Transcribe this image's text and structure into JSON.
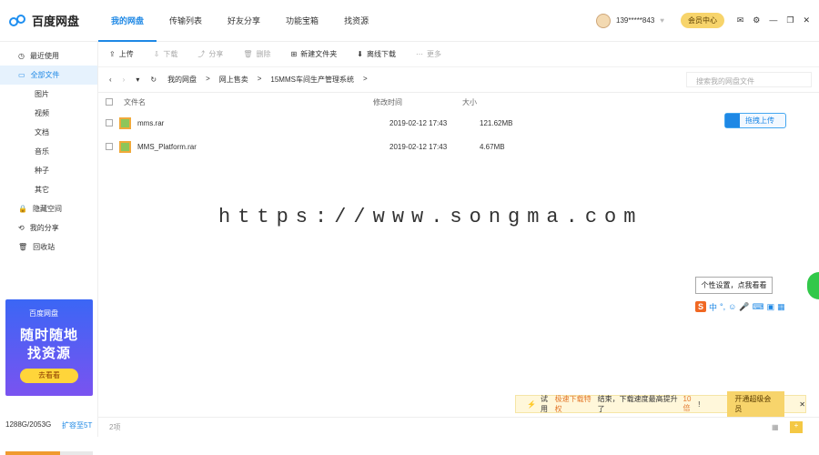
{
  "app": {
    "name": "百度网盘",
    "nav": [
      "我的网盘",
      "传输列表",
      "好友分享",
      "功能宝箱",
      "找资源"
    ],
    "user": "139*****843",
    "vip": "会员中心"
  },
  "sidebar": [
    {
      "label": "最近使用",
      "icon": "clock-icon"
    },
    {
      "label": "全部文件",
      "icon": "folder-icon",
      "active": true
    },
    {
      "label": "图片",
      "sub": true
    },
    {
      "label": "视频",
      "sub": true
    },
    {
      "label": "文档",
      "sub": true
    },
    {
      "label": "音乐",
      "sub": true
    },
    {
      "label": "种子",
      "sub": true
    },
    {
      "label": "其它",
      "sub": true
    },
    {
      "label": "隐藏空间",
      "icon": "lock-icon"
    },
    {
      "label": "我的分享",
      "icon": "share-icon"
    },
    {
      "label": "回收站",
      "icon": "trash-icon"
    }
  ],
  "ad": {
    "brand": "百度网盘",
    "line1": "随时随地",
    "line2": "找资源",
    "button": "去看看"
  },
  "quota": {
    "text": "1288G/2053G",
    "expand": "扩容至5T",
    "fraction": 0.627
  },
  "toolbar": [
    {
      "label": "上传"
    },
    {
      "label": "下载",
      "disabled": true
    },
    {
      "label": "分享",
      "disabled": true
    },
    {
      "label": "删除",
      "disabled": true
    },
    {
      "label": "新建文件夹"
    },
    {
      "label": "离线下载"
    },
    {
      "label": "更多",
      "disabled": true
    }
  ],
  "breadcrumb": [
    "我的网盘",
    "网上售卖",
    "15MMS车间生产管理系统"
  ],
  "search_placeholder": "搜索我的网盘文件",
  "columns": {
    "name": "文件名",
    "time": "修改时间",
    "size": "大小"
  },
  "files": [
    {
      "name": "mms.rar",
      "time": "2019-02-12 17:43",
      "size": "121.62MB"
    },
    {
      "name": "MMS_Platform.rar",
      "time": "2019-02-12 17:43",
      "size": "4.67MB"
    }
  ],
  "drag_upload": "拖拽上传",
  "watermark": "https://www.songma.com",
  "ime_tip": "个性设置，点我看看",
  "promo": {
    "text_pre": "试用",
    "text_hl": "极速下载特权",
    "text_mid": "结束，下载速度最高提升了",
    "highlight": "10倍",
    "text_end": "!",
    "button": "开通超级会员"
  },
  "item_count": "2项"
}
